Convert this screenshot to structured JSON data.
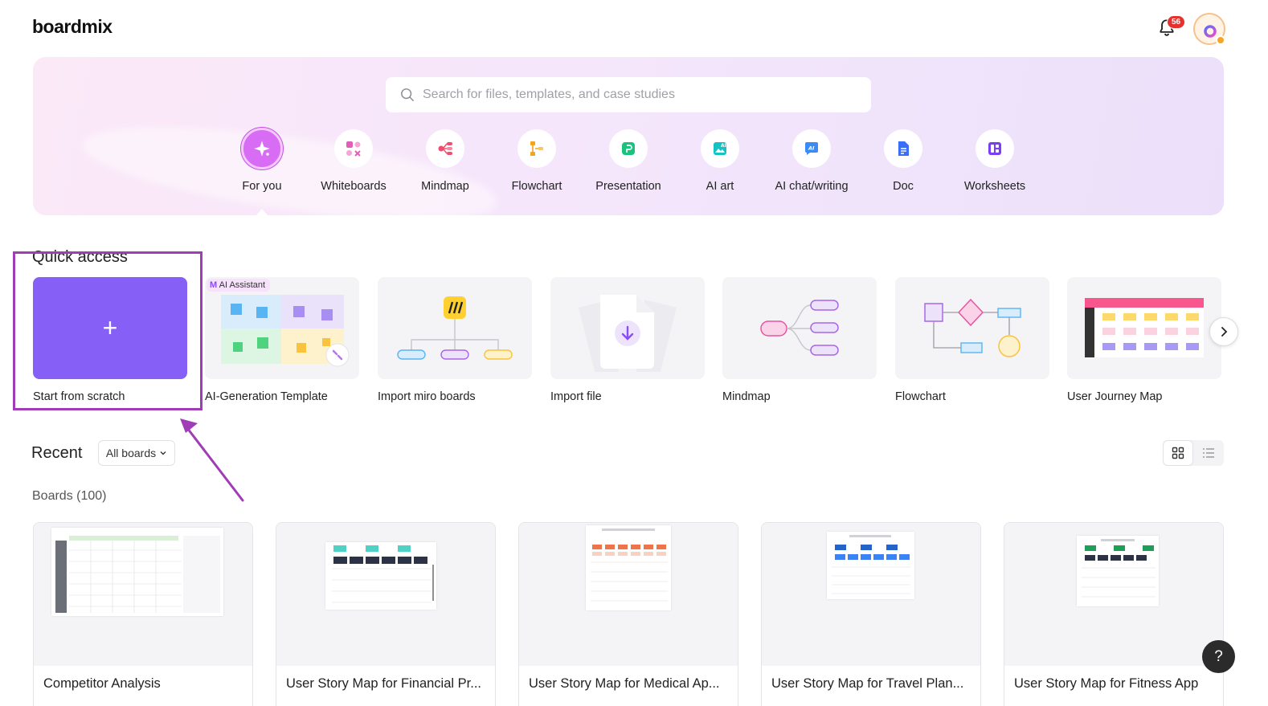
{
  "header": {
    "logo": "boardmix",
    "notification_count": "56"
  },
  "search": {
    "placeholder": "Search for files, templates, and case studies"
  },
  "categories": [
    {
      "label": "For you",
      "icon": "sparkle-icon",
      "active": true
    },
    {
      "label": "Whiteboards",
      "icon": "whiteboard-icon"
    },
    {
      "label": "Mindmap",
      "icon": "mindmap-icon"
    },
    {
      "label": "Flowchart",
      "icon": "flowchart-icon"
    },
    {
      "label": "Presentation",
      "icon": "presentation-icon"
    },
    {
      "label": "AI art",
      "icon": "ai-art-icon"
    },
    {
      "label": "AI chat/writing",
      "icon": "ai-chat-icon"
    },
    {
      "label": "Doc",
      "icon": "doc-icon"
    },
    {
      "label": "Worksheets",
      "icon": "worksheets-icon"
    }
  ],
  "quick_access": {
    "title": "Quick access",
    "ai_tag": "AI Assistant",
    "items": [
      {
        "label": "Start from scratch"
      },
      {
        "label": "AI-Generation Template"
      },
      {
        "label": "Import miro boards"
      },
      {
        "label": "Import file"
      },
      {
        "label": "Mindmap"
      },
      {
        "label": "Flowchart"
      },
      {
        "label": "User Journey Map"
      }
    ]
  },
  "recent": {
    "title": "Recent",
    "filter": "All boards",
    "boards_count": "Boards (100)",
    "boards": [
      {
        "name": "Competitor Analysis"
      },
      {
        "name": "User Story Map for Financial Pr..."
      },
      {
        "name": "User Story Map for Medical Ap..."
      },
      {
        "name": "User Story Map for Travel Plan..."
      },
      {
        "name": "User Story Map for Fitness App"
      }
    ]
  },
  "help": {
    "label": "?"
  },
  "colors": {
    "accent": "#8660f6",
    "highlight": "#a03cb5",
    "active_category": "#d86cf4"
  }
}
